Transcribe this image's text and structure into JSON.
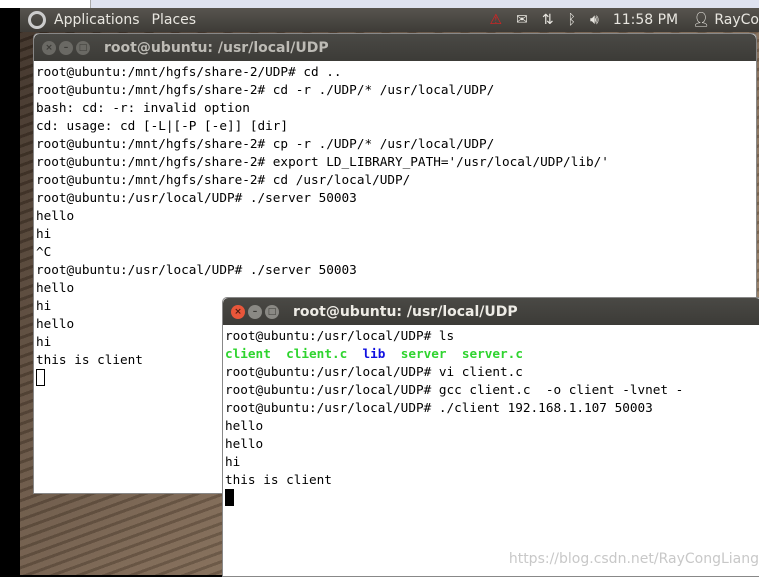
{
  "panel": {
    "menus": [
      "Applications",
      "Places"
    ],
    "clock": "11:58 PM",
    "user": "RayCo",
    "icons": [
      "warning-icon",
      "mail-icon",
      "network-icon",
      "bluetooth-icon",
      "volume-icon",
      "user-icon"
    ]
  },
  "term1": {
    "title": "root@ubuntu: /usr/local/UDP",
    "lines": [
      "root@ubuntu:/mnt/hgfs/share-2/UDP# cd ..",
      "root@ubuntu:/mnt/hgfs/share-2# cd -r ./UDP/* /usr/local/UDP/",
      "bash: cd: -r: invalid option",
      "cd: usage: cd [-L|[-P [-e]] [dir]",
      "root@ubuntu:/mnt/hgfs/share-2# cp -r ./UDP/* /usr/local/UDP/",
      "root@ubuntu:/mnt/hgfs/share-2# export LD_LIBRARY_PATH='/usr/local/UDP/lib/'",
      "root@ubuntu:/mnt/hgfs/share-2# cd /usr/local/UDP/",
      "root@ubuntu:/usr/local/UDP# ./server 50003",
      "hello",
      "hi",
      "^C",
      "root@ubuntu:/usr/local/UDP# ./server 50003",
      "hello",
      "hi",
      "hello",
      "hi",
      "this is client"
    ]
  },
  "term2": {
    "title": "root@ubuntu: /usr/local/UDP",
    "line0": "root@ubuntu:/usr/local/UDP# ls",
    "ls": [
      "client",
      "client.c",
      "lib",
      "server",
      "server.c"
    ],
    "lines": [
      "root@ubuntu:/usr/local/UDP# vi client.c",
      "root@ubuntu:/usr/local/UDP# gcc client.c  -o client -lvnet -",
      "root@ubuntu:/usr/local/UDP# ./client 192.168.1.107 50003",
      "hello",
      "hello",
      "hi",
      "this is client"
    ]
  },
  "watermark": "https://blog.csdn.net/RayCongLiang",
  "colors": {
    "exec": "#2fd42f",
    "dir": "#1010e0"
  }
}
